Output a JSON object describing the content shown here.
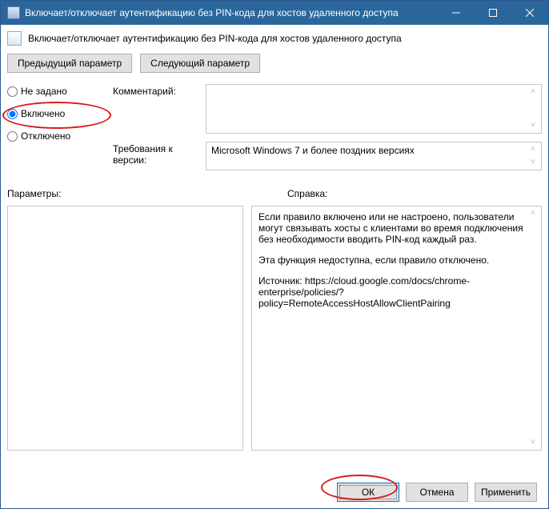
{
  "title": "Включает/отключает аутентификацию без PIN-кода для хостов удаленного доступа",
  "header_text": "Включает/отключает аутентификацию без PIN-кода для хостов удаленного доступа",
  "nav": {
    "prev": "Предыдущий параметр",
    "next": "Следующий параметр"
  },
  "radios": {
    "not_configured": "Не задано",
    "enabled": "Включено",
    "disabled": "Отключено",
    "selected": "enabled"
  },
  "labels": {
    "comment": "Комментарий:",
    "requirements": "Требования к версии:",
    "parameters": "Параметры:",
    "help": "Справка:"
  },
  "comment_value": "",
  "requirements_value": "Microsoft Windows 7 и более поздних версиях",
  "parameters_value": "",
  "help": {
    "p1": "Если правило включено или не настроено, пользователи могут связывать хосты с клиентами во время подключения без необходимости вводить PIN-код каждый раз.",
    "p2": "Эта функция недоступна, если правило отключено.",
    "p3": "Источник: https://cloud.google.com/docs/chrome-enterprise/policies/?policy=RemoteAccessHostAllowClientPairing"
  },
  "footer": {
    "ok": "ОК",
    "cancel": "Отмена",
    "apply": "Применить"
  }
}
